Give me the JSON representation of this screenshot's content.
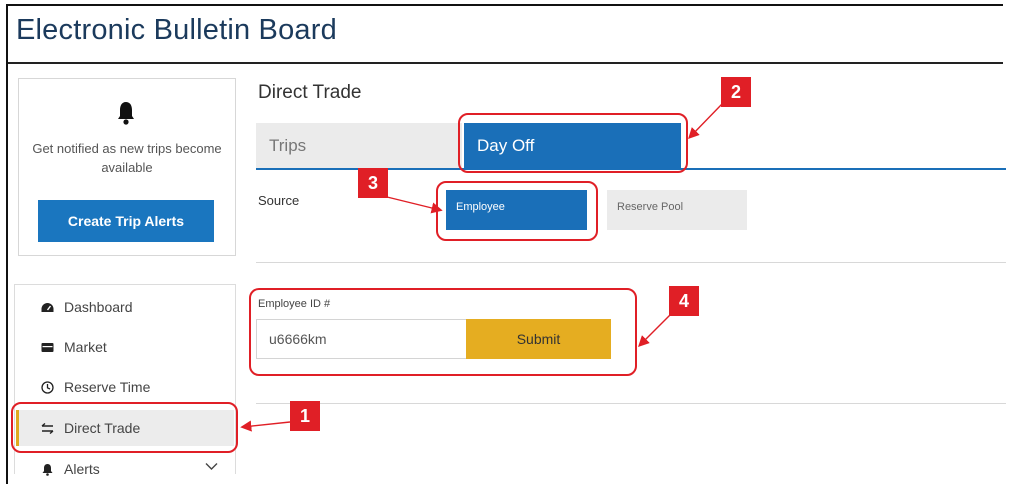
{
  "app": {
    "title": "Electronic Bulletin Board"
  },
  "alerts_card": {
    "message": "Get notified as new trips become available",
    "button_label": "Create Trip Alerts"
  },
  "sidebar": {
    "items": [
      {
        "label": "Dashboard",
        "icon": "dashboard-icon"
      },
      {
        "label": "Market",
        "icon": "market-icon"
      },
      {
        "label": "Reserve Time",
        "icon": "clock-icon"
      },
      {
        "label": "Direct Trade",
        "icon": "swap-icon",
        "active": true
      },
      {
        "label": "Alerts",
        "icon": "bell-icon",
        "expandable": true
      }
    ]
  },
  "main": {
    "title": "Direct Trade",
    "tabs": [
      {
        "label": "Trips",
        "selected": false
      },
      {
        "label": "Day Off",
        "selected": true
      }
    ],
    "source": {
      "label": "Source",
      "options": [
        {
          "label": "Employee",
          "selected": true
        },
        {
          "label": "Reserve Pool",
          "selected": false
        }
      ]
    },
    "employee_id": {
      "label": "Employee ID #",
      "value": "u6666km",
      "submit_label": "Submit"
    }
  },
  "annotations": {
    "callouts": [
      "1",
      "2",
      "3",
      "4"
    ],
    "color": "#e01f26"
  },
  "colors": {
    "primary_blue": "#1a6fb8",
    "button_blue": "#1a76bf",
    "submit_gold": "#e5ad21",
    "active_accent": "#e0a91f",
    "title_navy": "#1b3a5c"
  }
}
